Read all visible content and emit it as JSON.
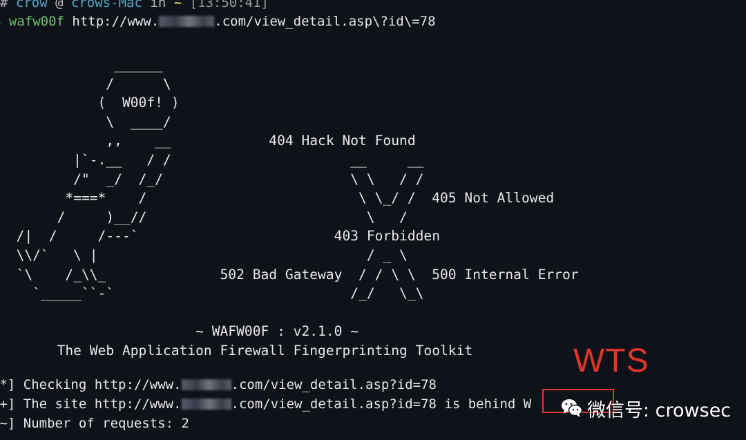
{
  "prompt": {
    "hash": "# ",
    "user": "crow",
    "at": " @ ",
    "host": "crows-Mac",
    "in_word": " in ",
    "dir": "~",
    "time": " [13:50:41]"
  },
  "command": {
    "prefix": "$ ",
    "name": "wafw00f",
    "url_before": " http://www.",
    "url_after": ".com/view_detail.asp\\?id\\=78"
  },
  "banner_ascii": "              ______\n             /      \\\n            (  W00f! )\n             \\  ____/\n             ,,    __            404 Hack Not Found\n         |`-.__   / /                      __     __\n         /\"  _/  /_/                       \\ \\   / /\n        *===*    /                          \\ \\_/ /  405 Not Allowed\n       /     )__//                           \\   /\n  /|  /     /---`                        403 Forbidden\n  \\\\/`   \\ |                                 / _ \\\n  `\\    /_\\\\_              502 Bad Gateway  / / \\ \\  500 Internal Error\n    `_____``-`                             /_/   \\_\\\n\n                        ~ WAFW00F : v2.1.0 ~\n       The Web Application Firewall Fingerprinting Toolkit",
  "output": {
    "line1_prefix": "[*] Checking http://www.",
    "line1_suffix": ".com/view_detail.asp?id=78",
    "line2_prefix": "[+] The site http://www.",
    "line2_suffix": ".com/view_detail.asp?id=78 is behind W",
    "line3": "[~] Number of requests: 2"
  },
  "watermark": {
    "wts_text": "WTS",
    "wechat_text": "微信号: crowsec",
    "color": "#e0352b"
  }
}
